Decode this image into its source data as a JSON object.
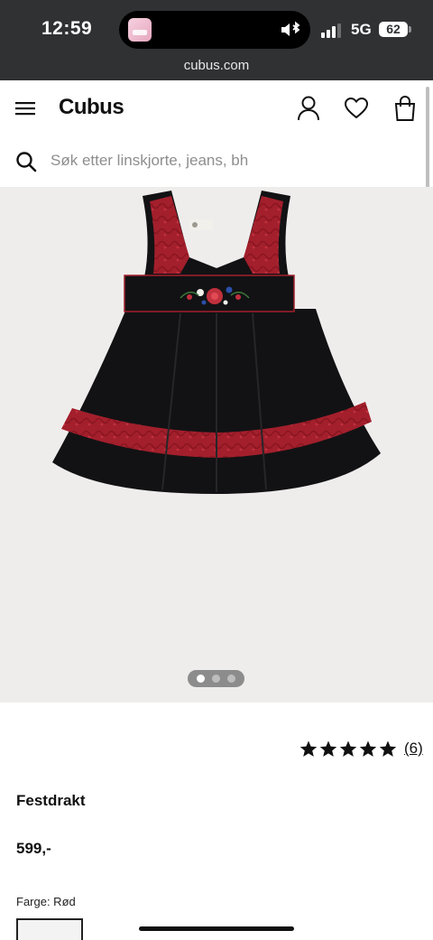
{
  "status_bar": {
    "time": "12:59",
    "network": "5G",
    "battery": "62",
    "url": "cubus.com"
  },
  "header": {
    "logo": "Cubus",
    "icons": [
      "menu-icon",
      "user-icon",
      "heart-icon",
      "shopping-bag-icon"
    ]
  },
  "search": {
    "placeholder": "Søk etter linskjorte, jeans, bh"
  },
  "gallery": {
    "image": "red and black children's folk dress",
    "slides": 3,
    "active_slide": 1,
    "background": "#efedec"
  },
  "product": {
    "rating": 5,
    "review_count": "(6)",
    "title": "Festdrakt",
    "price": "599,-",
    "color_label": "Farge: Rød"
  },
  "colors": {
    "status_bar": "#2f3133",
    "dress_red": "#a31f2c",
    "dress_black": "#121214"
  }
}
